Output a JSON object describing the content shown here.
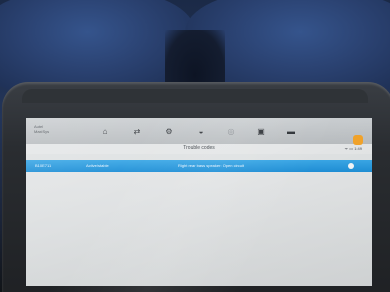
{
  "header": {
    "brand_line1": "Autel",
    "brand_line2": "MaxiSys"
  },
  "toolbar": {
    "icons": [
      "home-icon",
      "swap-icon",
      "gear-icon",
      "car-icon",
      "globe-icon",
      "save-icon",
      "printer-icon"
    ]
  },
  "screen": {
    "title": "Trouble codes",
    "status": "ᯤ ▭ 1:49"
  },
  "dtc": {
    "code": "B10E711",
    "status": "Active/stable",
    "description": "Right rear bass speaker: Open circuit"
  },
  "colors": {
    "row_highlight": "#2196d8",
    "accent_button": "#f0a22a"
  }
}
